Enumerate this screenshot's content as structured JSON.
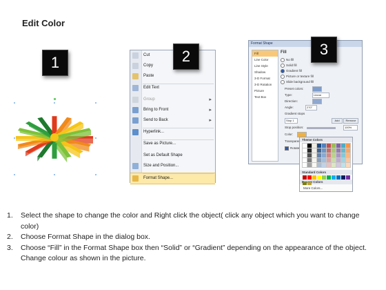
{
  "title": "Edit Color",
  "badges": [
    "1",
    "2",
    "3"
  ],
  "context_menu": {
    "items": [
      {
        "label": "Cut",
        "color": "#c9d2de",
        "disabled": false,
        "submenu": false
      },
      {
        "label": "Copy",
        "color": "#c9d2de",
        "disabled": false,
        "submenu": false
      },
      {
        "label": "Paste",
        "color": "#e4c36c",
        "disabled": false,
        "submenu": false
      },
      {
        "label": "Edit Text",
        "color": "#9fb6d8",
        "disabled": false,
        "submenu": false
      },
      {
        "label": "Group",
        "color": "#cfd5dc",
        "disabled": true,
        "submenu": true
      },
      {
        "label": "Bring to Front",
        "color": "#7aa0d0",
        "disabled": false,
        "submenu": true
      },
      {
        "label": "Send to Back",
        "color": "#7aa0d0",
        "disabled": false,
        "submenu": true
      },
      {
        "label": "Hyperlink...",
        "color": "#5c8fcc",
        "disabled": false,
        "submenu": false
      },
      {
        "label": "Save as Picture...",
        "color": "",
        "disabled": false,
        "submenu": false
      },
      {
        "label": "Set as Default Shape",
        "color": "",
        "disabled": false,
        "submenu": false
      },
      {
        "label": "Size and Position...",
        "color": "#8fb0d8",
        "disabled": false,
        "submenu": false
      },
      {
        "label": "Format Shape...",
        "color": "#e6b84a",
        "disabled": false,
        "submenu": false,
        "highlighted": true
      }
    ]
  },
  "format_dialog": {
    "title": "Format Shape",
    "sidebar": [
      "Fill",
      "Line Color",
      "Line Style",
      "Shadow",
      "3-D Format",
      "3-D Rotation",
      "Picture",
      "Text Box"
    ],
    "section": "Fill",
    "options": [
      "No fill",
      "Solid fill",
      "Gradient fill",
      "Picture or texture fill",
      "Slide background fill"
    ],
    "selected_option": "Gradient fill",
    "preset_label": "Preset colors:",
    "type_label": "Type:",
    "type_value": "Linear",
    "direction_label": "Direction:",
    "angle_label": "Angle:",
    "angle_value": "270°",
    "stops_label": "Gradient stops",
    "stop_value": "Stop 1",
    "add_button": "Add",
    "remove_button": "Remove",
    "stop_position_label": "Stop position:",
    "stop_position_value": "100%",
    "color_label": "Color:",
    "transparency_label": "Transparency:",
    "rotate_label": "Rotate"
  },
  "palette": {
    "theme_header": "Theme Colors",
    "standard_header": "Standard Colors",
    "recent_header": "Recent Colors",
    "more_label": "More Colors...",
    "theme_top": [
      "#ffffff",
      "#000000",
      "#eeece1",
      "#1f497d",
      "#4f81bd",
      "#c0504d",
      "#9bbb59",
      "#8064a2",
      "#4bacc6",
      "#f79646"
    ],
    "standard": [
      "#c00000",
      "#ff0000",
      "#ffc000",
      "#ffff00",
      "#92d050",
      "#00b050",
      "#00b0f0",
      "#0070c0",
      "#002060",
      "#7030a0"
    ],
    "recent": [
      "#7f7f00",
      "#bfa030"
    ]
  },
  "shape_colors": [
    "#e03a1c",
    "#f08a1a",
    "#f5c518",
    "#7cc23a",
    "#2e9e3e",
    "#1f7a2e"
  ],
  "steps": [
    {
      "num": "1.",
      "text": "Select the shape to change the color and Right click the object( click any object which you want to change color)"
    },
    {
      "num": "2.",
      "text": "Choose Format Shape in the dialog box."
    },
    {
      "num": "3.",
      "text": "Choose “Fill” in the Format Shape box then “Solid” or “Gradient” depending on the appearance of the object. Change colour as shown in the picture."
    }
  ]
}
